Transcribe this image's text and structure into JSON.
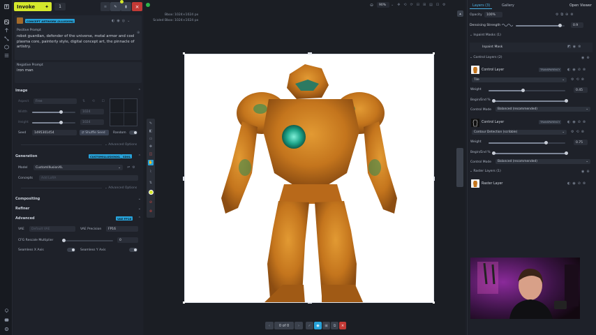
{
  "header": {
    "invoke_label": "Invoke",
    "queue_count": "1"
  },
  "left_panel": {
    "positive_prompt": {
      "title": "Positive Prompt",
      "style_badge": "CONCEPT ARTWORK (ILLUSION)",
      "text": "robot guardian, defender of the universe, metal armor and cool plasma core, painterly style, digital concept art, the pinnacle of artistry."
    },
    "negative_prompt": {
      "title": "Negative Prompt",
      "text": "iron man"
    },
    "image_section": {
      "title": "Image",
      "aspect_label": "Aspect",
      "aspect_value": "Free",
      "width_label": "Width",
      "width_value": "1024",
      "height_label": "Height",
      "height_value": "1024",
      "seed_label": "Seed",
      "seed_value": "1495301454",
      "shuffle_label": "Shuffle Seed",
      "random_label": "Random",
      "advanced_options": "Advanced Options"
    },
    "generation_section": {
      "title": "Generation",
      "tag_model": "CUSTOMILLUSIONXL",
      "tag_sdxl": "SDXL",
      "model_label": "Model",
      "model_value": "CustomIllusionXL",
      "concepts_label": "Concepts",
      "concepts_placeholder": "Add LoRA",
      "advanced_options": "Advanced Options"
    },
    "compositing_title": "Compositing",
    "refiner_title": "Refiner",
    "advanced_section": {
      "title": "Advanced",
      "tag": "VAE FP16",
      "vae_label": "VAE",
      "vae_value": "Default VAE",
      "precision_label": "VAE Precision",
      "precision_value": "FP16",
      "cfg_label": "CFG Rescale Multiplier",
      "cfg_value": "0",
      "seamless_x": "Seamless X Axis",
      "seamless_y": "Seamless Y Axis"
    }
  },
  "canvas": {
    "bbox_label": "Bbox:",
    "bbox_value": "1024×1024 px",
    "scaled_label": "Scaled Bbox:",
    "scaled_value": "1024×1024 px",
    "zoom": "90%",
    "page_indicator": "0 of 0"
  },
  "right_panel": {
    "tab_layers": "Layers (3)",
    "tab_gallery": "Gallery",
    "open_viewer": "Open Viewer",
    "opacity_label": "Opacity",
    "opacity_value": "100%",
    "denoise_label": "Denoising Strength",
    "denoise_value": "0.9",
    "denoise_fraction": 0.9,
    "inpaint_masks": "Inpaint Masks (1)",
    "inpaint_mask": "Inpaint Mask",
    "control_layers": "Control Layers (2)",
    "control_layer_1": {
      "name": "Control Layer",
      "tag": "TRANSPARENCY",
      "model": "Tile",
      "weight_label": "Weight",
      "weight_value": "0.45",
      "weight_fraction": 0.45,
      "begin_end_label": "Begin/End %",
      "mode_label": "Control Mode",
      "mode_value": "Balanced (recommended)"
    },
    "control_layer_2": {
      "name": "Control Layer",
      "tag": "TRANSPARENCY",
      "model": "Contour Detection (scribble)",
      "weight_label": "Weight",
      "weight_value": "0.75",
      "weight_fraction": 0.75,
      "begin_end_label": "Begin/End %",
      "mode_label": "Control Mode",
      "mode_value": "Balanced (recommended)"
    },
    "raster_layers": "Raster Layers (1)",
    "raster_layer": "Raster Layer"
  },
  "colors": {
    "accent": "#d5e82c",
    "tag_blue": "#27a2d9",
    "danger": "#c0392b",
    "armor": "#c97a22"
  }
}
